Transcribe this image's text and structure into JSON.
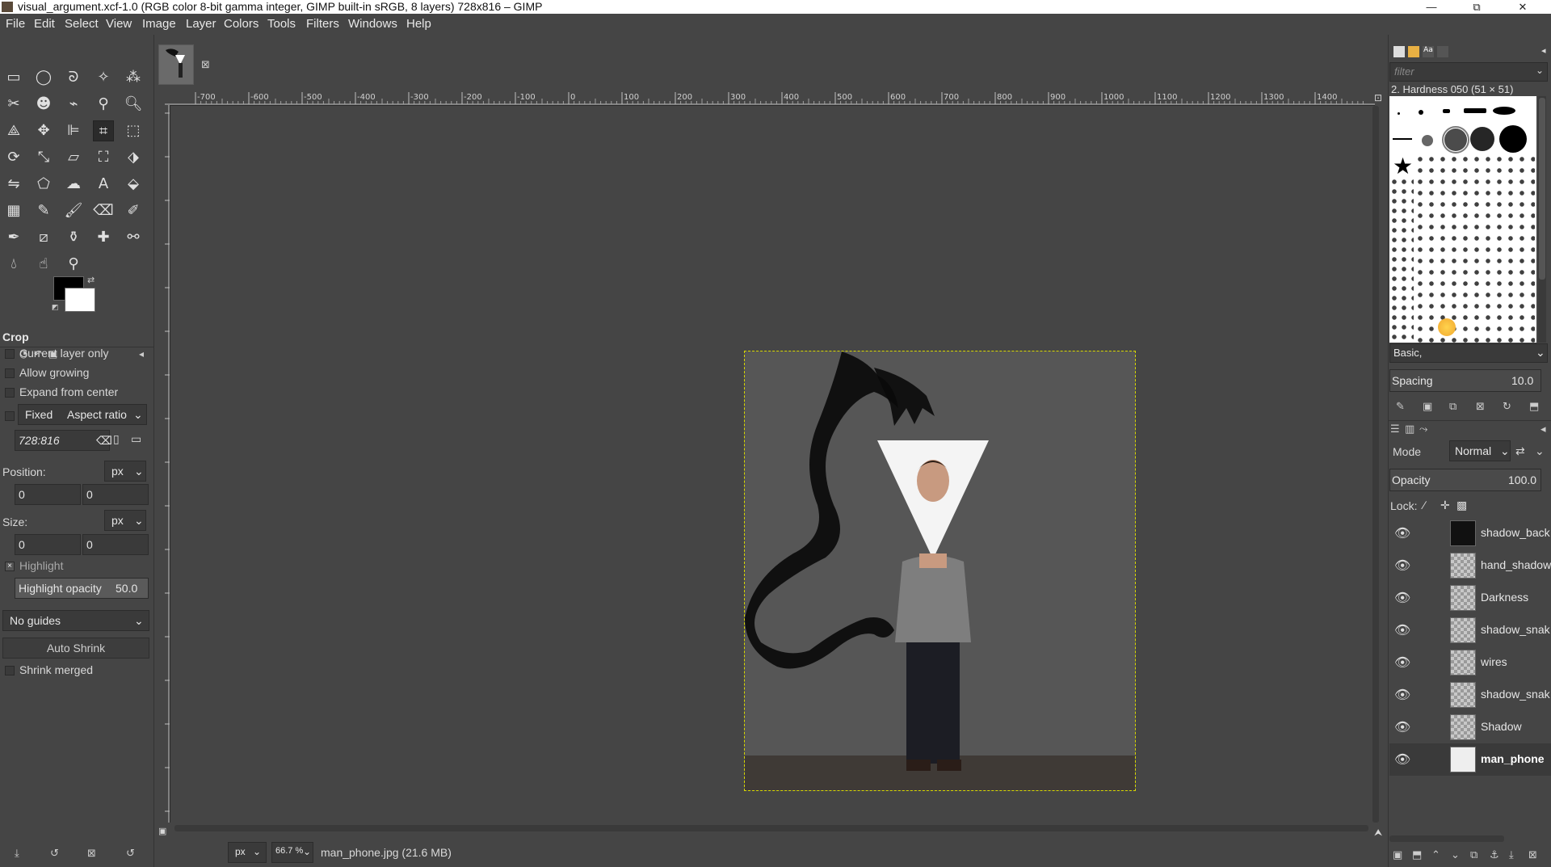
{
  "window": {
    "title": "visual_argument.xcf-1.0 (RGB color 8-bit gamma integer, GIMP built-in sRGB, 8 layers) 728x816 – GIMP",
    "controls": [
      "—",
      "⧉",
      "✕"
    ]
  },
  "menu": [
    "File",
    "Edit",
    "Select",
    "View",
    "Image",
    "Layer",
    "Colors",
    "Tools",
    "Filters",
    "Windows",
    "Help"
  ],
  "tool_options": {
    "tool_name": "Crop",
    "current_layer_only": "Current layer only",
    "allow_growing": "Allow growing",
    "expand_from_center": "Expand from center",
    "fixed": "Fixed",
    "fixed_mode": "Aspect ratio",
    "ratio_value": "728:816",
    "position_label": "Position:",
    "position_unit": "px",
    "position_x": "0",
    "position_y": "0",
    "size_label": "Size:",
    "size_unit": "px",
    "size_w": "0",
    "size_h": "0",
    "highlight": "Highlight",
    "highlight_opacity_label": "Highlight opacity",
    "highlight_opacity_value": "50.0",
    "guides": "No guides",
    "auto_shrink": "Auto Shrink",
    "shrink_merged": "Shrink merged"
  },
  "ruler_ticks": [
    "-700",
    "-600",
    "-500",
    "-400",
    "-300",
    "-200",
    "-100",
    "0",
    "100",
    "200",
    "300",
    "400",
    "500",
    "600",
    "700",
    "800",
    "900",
    "1000",
    "1100",
    "1200",
    "1300",
    "1400"
  ],
  "statusbar": {
    "unit": "px",
    "zoom": "66.7 %",
    "file_info": "man_phone.jpg (21.6 MB)"
  },
  "brushes": {
    "filter_placeholder": "filter",
    "selected_brush": "2. Hardness 050 (51 × 51)",
    "preset": "Basic,",
    "spacing_label": "Spacing",
    "spacing_value": "10.0"
  },
  "layers_panel": {
    "mode_label": "Mode",
    "mode_value": "Normal",
    "opacity_label": "Opacity",
    "opacity_value": "100.0",
    "lock_label": "Lock:",
    "layers": [
      {
        "name": "shadow_back"
      },
      {
        "name": "hand_shadow"
      },
      {
        "name": "Darkness"
      },
      {
        "name": "shadow_snak"
      },
      {
        "name": "wires"
      },
      {
        "name": "shadow_snak"
      },
      {
        "name": "Shadow"
      },
      {
        "name": "man_phone"
      }
    ]
  },
  "colors": {
    "accent_selection": "#d8d800",
    "foreground": "#000000",
    "background": "#ffffff"
  }
}
